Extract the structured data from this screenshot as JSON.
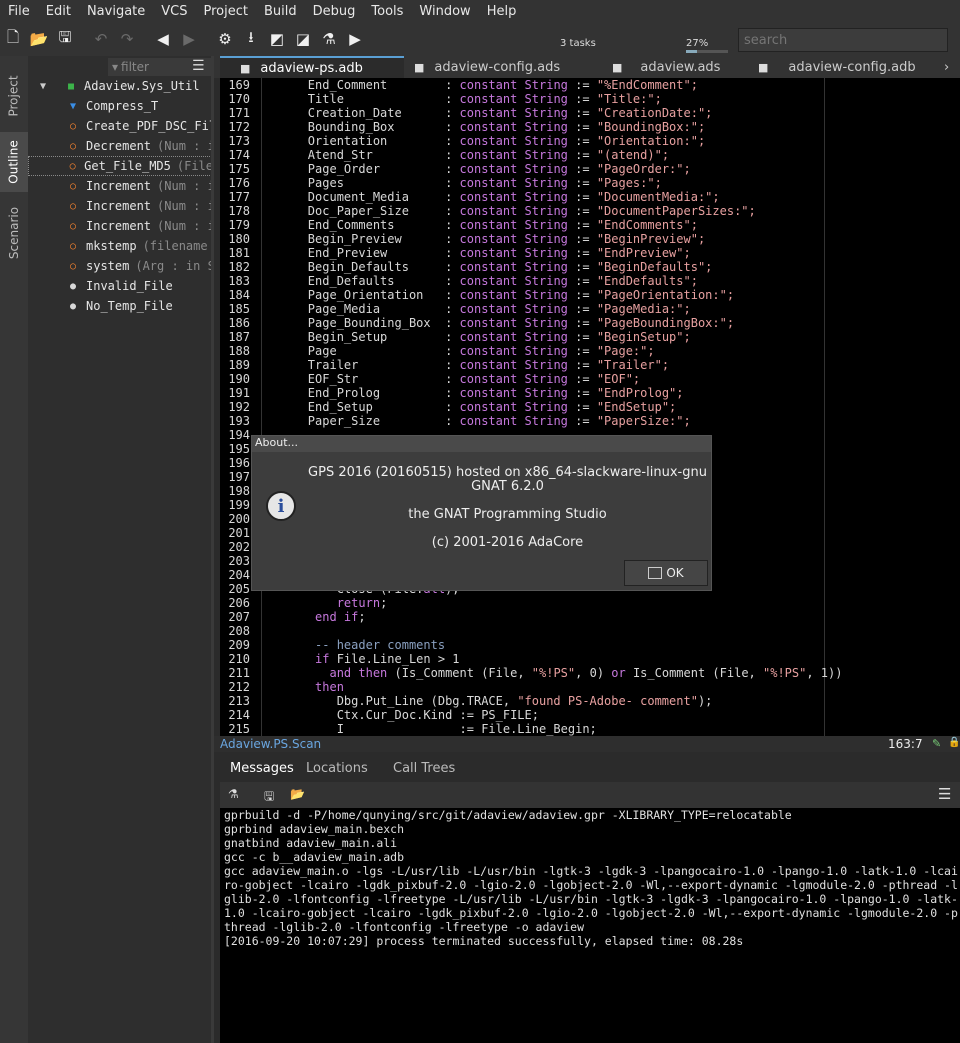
{
  "menubar": [
    "File",
    "Edit",
    "Navigate",
    "VCS",
    "Project",
    "Build",
    "Debug",
    "Tools",
    "Window",
    "Help"
  ],
  "toolbar": {
    "tasks": "3 tasks",
    "progress": "27%",
    "progress_value": 0.27,
    "search_placeholder": "search"
  },
  "side_tabs": [
    "Project",
    "Outline",
    "Scenario"
  ],
  "outline": {
    "filter_placeholder": "filter",
    "items": [
      {
        "name": "Adaview.Sys_Util",
        "sig": "",
        "icon": "package-icon"
      },
      {
        "name": "Compress_T",
        "sig": "",
        "icon": "type-icon"
      },
      {
        "name": "Create_PDF_DSC_Fil",
        "sig": "",
        "icon": "subprogram-icon"
      },
      {
        "name": "Decrement",
        "sig": "(Num : i",
        "icon": "subprogram-icon"
      },
      {
        "name": "Get_File_MD5",
        "sig": "(File",
        "icon": "subprogram-icon"
      },
      {
        "name": "Increment",
        "sig": "(Num : i",
        "icon": "subprogram-icon"
      },
      {
        "name": "Increment",
        "sig": "(Num : i",
        "icon": "subprogram-icon"
      },
      {
        "name": "Increment",
        "sig": "(Num : i",
        "icon": "subprogram-icon"
      },
      {
        "name": "mkstemp",
        "sig": "(filename",
        "icon": "subprogram-icon"
      },
      {
        "name": "system",
        "sig": "(Arg : in S",
        "icon": "subprogram-icon"
      },
      {
        "name": "Invalid_File",
        "sig": "",
        "icon": "object-icon"
      },
      {
        "name": "No_Temp_File",
        "sig": "",
        "icon": "object-icon"
      }
    ]
  },
  "editor_tabs": [
    "adaview-ps.adb",
    "adaview-config.ads",
    "adaview.ads",
    "adaview-config.adb"
  ],
  "code": [
    {
      "n": "169",
      "name": "End_Comment",
      "val": "\"%EndComment\";"
    },
    {
      "n": "170",
      "name": "Title",
      "val": "\"Title:\";"
    },
    {
      "n": "171",
      "name": "Creation_Date",
      "val": "\"CreationDate:\";"
    },
    {
      "n": "172",
      "name": "Bounding_Box",
      "val": "\"BoundingBox:\";"
    },
    {
      "n": "173",
      "name": "Orientation",
      "val": "\"Orientation:\";"
    },
    {
      "n": "174",
      "name": "Atend_Str",
      "val": "\"(atend)\";"
    },
    {
      "n": "175",
      "name": "Page_Order",
      "val": "\"PageOrder:\";"
    },
    {
      "n": "176",
      "name": "Pages",
      "val": "\"Pages:\";"
    },
    {
      "n": "177",
      "name": "Document_Media",
      "val": "\"DocumentMedia:\";"
    },
    {
      "n": "178",
      "name": "Doc_Paper_Size",
      "val": "\"DocumentPaperSizes:\";"
    },
    {
      "n": "179",
      "name": "End_Comments",
      "val": "\"EndComments\";"
    },
    {
      "n": "180",
      "name": "Begin_Preview",
      "val": "\"BeginPreview\";"
    },
    {
      "n": "181",
      "name": "End_Preview",
      "val": "\"EndPreview\";"
    },
    {
      "n": "182",
      "name": "Begin_Defaults",
      "val": "\"BeginDefaults\";"
    },
    {
      "n": "183",
      "name": "End_Defaults",
      "val": "\"EndDefaults\";"
    },
    {
      "n": "184",
      "name": "Page_Orientation",
      "val": "\"PageOrientation:\";"
    },
    {
      "n": "185",
      "name": "Page_Media",
      "val": "\"PageMedia:\";"
    },
    {
      "n": "186",
      "name": "Page_Bounding_Box",
      "val": "\"PageBoundingBox:\";"
    },
    {
      "n": "187",
      "name": "Begin_Setup",
      "val": "\"BeginSetup\";"
    },
    {
      "n": "188",
      "name": "Page",
      "val": "\"Page:\";"
    },
    {
      "n": "189",
      "name": "Trailer",
      "val": "\"Trailer\";"
    },
    {
      "n": "190",
      "name": "EOF_Str",
      "val": "\"EOF\";"
    },
    {
      "n": "191",
      "name": "End_Prolog",
      "val": "\"EndProlog\";"
    },
    {
      "n": "192",
      "name": "End_Setup",
      "val": "\"EndSetup\";"
    },
    {
      "n": "193",
      "name": "Paper_Size",
      "val": "\"PaperSize:\";"
    }
  ],
  "code_keywords": {
    "constant": "constant",
    "string": "String",
    "assign": ":="
  },
  "hidden_line_numbers": [
    "194",
    "195",
    "196",
    "197",
    "198",
    "199",
    "200",
    "201",
    "202",
    "203",
    "204"
  ],
  "code_tail": [
    {
      "n": "205",
      "text": "      Close (File.all);"
    },
    {
      "n": "206",
      "text": "      return;"
    },
    {
      "n": "207",
      "text": "   end if;"
    },
    {
      "n": "208",
      "text": ""
    },
    {
      "n": "209",
      "text": "   -- header comments"
    },
    {
      "n": "210",
      "text": "   if File.Line_Len > 1"
    },
    {
      "n": "211",
      "text": "     and then (Is_Comment (File, \"%!PS\", 0) or Is_Comment (File, \"%!PS\", 1))"
    },
    {
      "n": "212",
      "text": "   then"
    },
    {
      "n": "213",
      "text": "      Dbg.Put_Line (Dbg.TRACE, \"found PS-Adobe- comment\");"
    },
    {
      "n": "214",
      "text": "      Ctx.Cur_Doc.Kind := PS_FILE;"
    },
    {
      "n": "215",
      "text": "      I                := File.Line_Begin;"
    }
  ],
  "status": {
    "crumb": "Adaview.PS.Scan",
    "position": "163:7"
  },
  "message_tabs": [
    "Messages",
    "Locations",
    "Call Trees"
  ],
  "messages": [
    "gprbuild -d -P/home/qunying/src/git/adaview/adaview.gpr -XLIBRARY_TYPE=relocatable",
    "gprbind adaview_main.bexch",
    "gnatbind adaview_main.ali",
    "gcc -c b__adaview_main.adb",
    "gcc adaview_main.o -lgs -L/usr/lib -L/usr/bin -lgtk-3 -lgdk-3 -lpangocairo-1.0 -lpango-1.0 -latk-1.0 -lcairo-gobject -lcairo -lgdk_pixbuf-2.0 -lgio-2.0 -lgobject-2.0 -Wl,--export-dynamic -lgmodule-2.0 -pthread -lglib-2.0 -lfontconfig -lfreetype -L/usr/lib -L/usr/bin -lgtk-3 -lgdk-3 -lpangocairo-1.0 -lpango-1.0 -latk-1.0 -lcairo-gobject -lcairo -lgdk_pixbuf-2.0 -lgio-2.0 -lgobject-2.0 -Wl,--export-dynamic -lgmodule-2.0 -pthread -lglib-2.0 -lfontconfig -lfreetype -o adaview",
    "[2016-09-20 10:07:29] process terminated successfully, elapsed time: 08.28s"
  ],
  "dialog": {
    "title": "About...",
    "lines": [
      "GPS 2016 (20160515) hosted on x86_64-slackware-linux-gnu",
      "GNAT 6.2.0",
      "the GNAT Programming Studio",
      "(c) 2001-2016 AdaCore"
    ],
    "ok": "OK"
  },
  "colors": {
    "keyword": "#c678dd",
    "string": "#e7a0a0",
    "accent": "#5a9fd4"
  }
}
